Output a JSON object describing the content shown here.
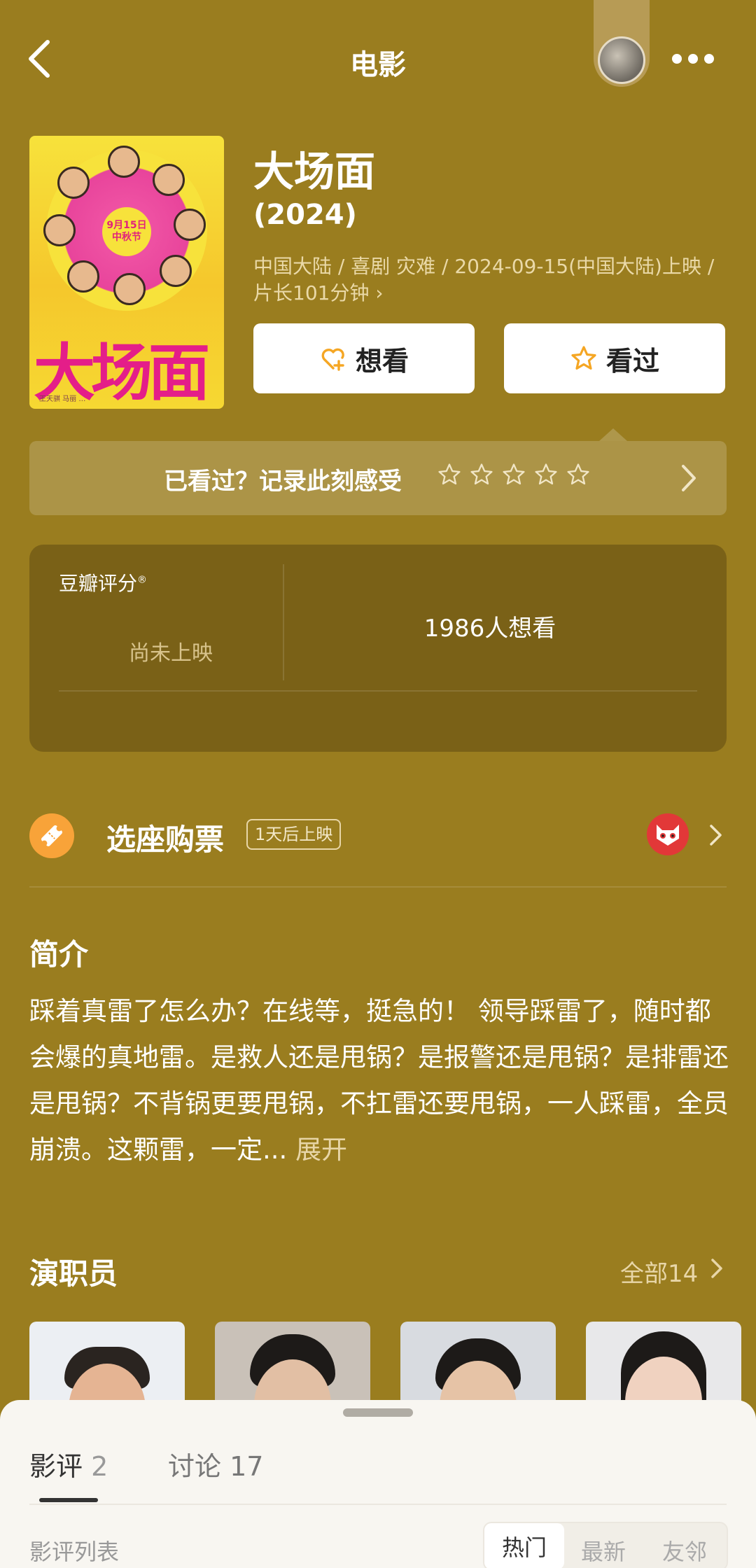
{
  "header": {
    "title": "电影"
  },
  "poster": {
    "date_badge": "9月15日\n中秋节",
    "big_title": "大场面",
    "credits": "王天骐 马丽 …"
  },
  "movie": {
    "title": "大场面",
    "year": "(2024)",
    "meta": "中国大陆 / 喜剧 灾难 / 2024-09-15(中国大陆)上映 / 片长101分钟 ›"
  },
  "actions": {
    "want_label": "想看",
    "seen_label": "看过"
  },
  "record": {
    "prompt": "已看过？记录此刻感受",
    "stars": 5
  },
  "rating": {
    "label": "豆瓣评分",
    "registered_mark": "®",
    "status": "尚未上映",
    "want_count_text": "1986人想看"
  },
  "ticket": {
    "label": "选座购票",
    "badge": "1天后上映"
  },
  "synopsis": {
    "title": "简介",
    "text": "踩着真雷了怎么办？在线等，挺急的！ 领导踩雷了，随时都会爆的真地雷。是救人还是甩锅？是报警还是甩锅？是排雷还是甩锅？不背锅更要甩锅，不扛雷还要甩锅，一人踩雷，全员崩溃。这颗雷，一定...",
    "expand_label": "展开"
  },
  "cast": {
    "title": "演职员",
    "all_label": "全部14"
  },
  "sheet": {
    "tabs": [
      {
        "label": "影评",
        "count": "2"
      },
      {
        "label": "讨论",
        "count": "17"
      }
    ],
    "list_label": "影评列表",
    "sort_options": [
      "热门",
      "最新",
      "友邻"
    ]
  },
  "colors": {
    "background": "#9a7d1f",
    "sheet": "#f8f6f1",
    "accent_orange": "#f8a339",
    "poster_pink": "#e41e89"
  },
  "icons": [
    "back-icon",
    "more-icon",
    "heart-plus-icon",
    "star-icon",
    "chevron-right-icon",
    "ticket-icon",
    "maoyan-cat-icon"
  ]
}
